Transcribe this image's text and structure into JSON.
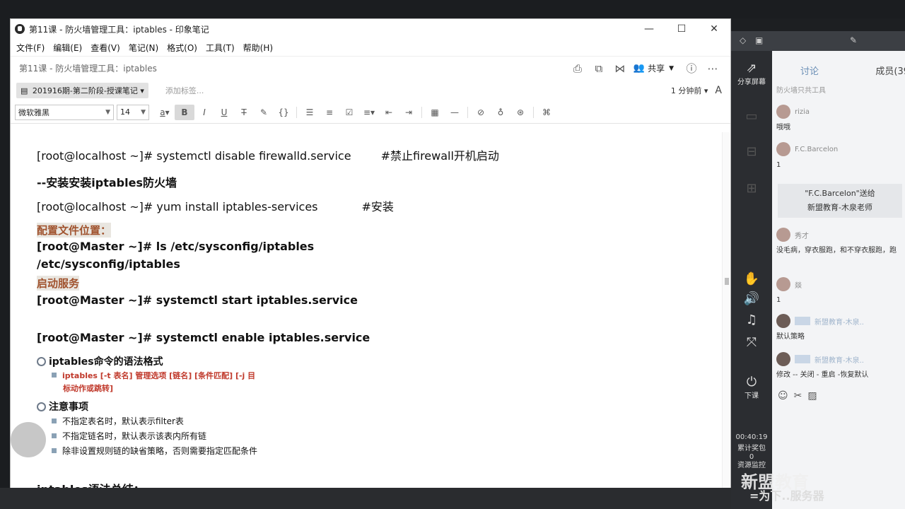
{
  "window": {
    "title": "第11课 - 防火墙管理工具：iptables - 印象笔记",
    "controls": {
      "minimize": "—",
      "maximize": "☐",
      "close": "✕"
    }
  },
  "menu": [
    "文件(F)",
    "编辑(E)",
    "查看(V)",
    "笔记(N)",
    "格式(O)",
    "工具(T)",
    "帮助(H)"
  ],
  "note": {
    "title": "第11课 - 防火墙管理工具：iptables",
    "share_label": "共享",
    "notebook": "201916期-第二阶段-授课笔记",
    "add_tag": "添加标签...",
    "time": "1 分钟前"
  },
  "format": {
    "font": "微软雅黑",
    "size": "14"
  },
  "content": {
    "line1_prompt": "[root@localhost ~]# systemctl disable firewalld.service",
    "line1_comment": "#禁止firewall开机启动",
    "line2": "--安装安装iptables防火墙",
    "line3_prompt": "[root@localhost ~]# yum install iptables-services",
    "line3_comment": "#安装",
    "line4": "配置文件位置：",
    "line5": "[root@Master ~]# ls /etc/sysconfig/iptables",
    "line6": "/etc/sysconfig/iptables",
    "line7": "启动服务",
    "line8": "[root@Master ~]# systemctl start iptables.service",
    "line9": "[root@Master ~]# systemctl enable iptables.service",
    "sec1": "iptables命令的语法格式",
    "sec1_item_a": "iptables  [-t 表名]  管理选项  [链名]  [条件匹配]  [-j 目",
    "sec1_item_b": "标动作或跳转]",
    "sec2": "注意事项",
    "sec2_items": [
      "不指定表名时，默认表示filter表",
      "不指定链名时，默认表示该表内所有链",
      "除非设置规则链的缺省策略，否则需要指定匹配条件"
    ],
    "line10": "iptables语法总结："
  },
  "sidebar": {
    "share_screen": "分享屏幕",
    "leave": "下课",
    "timer": "00:40:19",
    "stat1": "累计奖包",
    "stat1_val": "0",
    "stat2": "资源监控"
  },
  "chat": {
    "tab_discuss": "讨论",
    "tab_members": "成员(39",
    "top_cut": "防火墙只共工具",
    "messages": [
      {
        "name": "rizia",
        "text": "哦哦"
      },
      {
        "name": "F.C.Barcelon",
        "text": "1"
      },
      {
        "name": "秀才",
        "text": "没毛病，穿衣服跑，和不穿衣服跑，跑"
      },
      {
        "name": "燚",
        "text": "1"
      },
      {
        "name": "新盟教育-木泉..",
        "text": "默认策略"
      },
      {
        "name": "新盟教育-木泉..",
        "text": "修改 -- 关闭 - 重启 -恢复默认"
      }
    ],
    "gift_line1": "\"F.C.Barcelon\"送给",
    "gift_line2": "新盟教育-木泉老师"
  },
  "watermark": "新盟教育",
  "watermark2": "=为下..服务器"
}
